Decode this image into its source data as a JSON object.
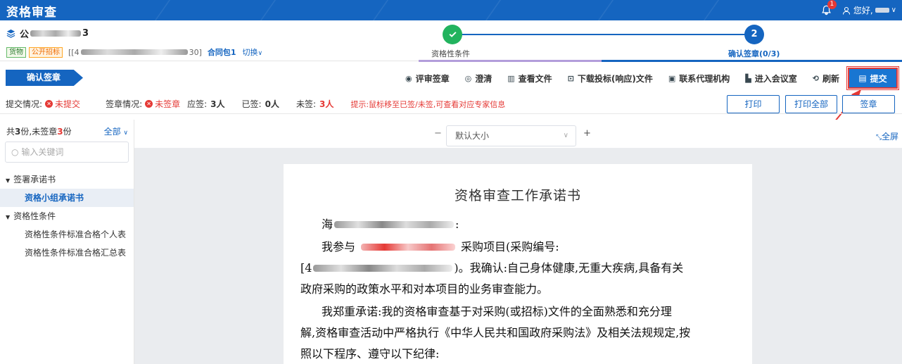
{
  "app": {
    "title": "资格审查",
    "notifications": "1",
    "greeting": "您好,"
  },
  "project": {
    "name_prefix": "公",
    "name_suffix": "3",
    "tag_goods": "货物",
    "tag_open": "公开招标",
    "code_prefix": "[[4",
    "code_suffix": "30]",
    "package": "合同包1",
    "switch": "切换"
  },
  "steps": [
    {
      "label": "资格性条件",
      "state": "done"
    },
    {
      "number": "2",
      "label": "确认签章(0/3)",
      "state": "active"
    }
  ],
  "action_bar": {
    "tab": "确认签章",
    "actions": [
      "评审签章",
      "澄清",
      "查看文件",
      "下载投标(响应)文件",
      "联系代理机构",
      "进入会议室",
      "刷新"
    ],
    "submit": "提交"
  },
  "status": {
    "submit_label": "提交情况:",
    "submit_value": "未提交",
    "sign_label": "签章情况:",
    "sign_value": "未签章",
    "should_label": "应签:",
    "should_value": "3人",
    "signed_label": "已签:",
    "signed_value": "0人",
    "unsigned_label": "未签:",
    "unsigned_value": "3人",
    "hint": "提示:鼠标移至已签/未签,可查看对应专家信息"
  },
  "buttons": {
    "print": "打印",
    "print_all": "打印全部",
    "sign": "签章"
  },
  "sidebar": {
    "summary_a": "共",
    "summary_n1": "3",
    "summary_b": "份,未签章",
    "summary_n2": "3",
    "summary_c": "份",
    "filter": "全部",
    "search_placeholder": "输入关键词",
    "tree": [
      {
        "label": "签署承诺书",
        "level": 0
      },
      {
        "label": "资格小组承诺书",
        "level": 1,
        "selected": true
      },
      {
        "label": "资格性条件",
        "level": 0
      },
      {
        "label": "资格性条件标准合格个人表",
        "level": 1
      },
      {
        "label": "资格性条件标准合格汇总表",
        "level": 1
      }
    ]
  },
  "viewer": {
    "zoom_minus": "−",
    "zoom_value": "默认大小",
    "zoom_plus": "+",
    "fullscreen": "全屏"
  },
  "document": {
    "title": "资格审查工作承诺书",
    "l1_start": "海",
    "l1_end": ":",
    "l2_start": "我参与",
    "l2_end": "采购项目(采购编号:",
    "l3_start": "[4",
    "l3_end": ")。我确认:自己身体健康,无重大疾病,具备有关",
    "l4": "政府采购的政策水平和对本项目的业务审查能力。",
    "l5": "我郑重承诺:我的资格审查基于对采购(或招标)文件的全面熟悉和充分理",
    "l6": "解,资格审查活动中严格执行《中华人民共和国政府采购法》及相关法规规定,按",
    "l7": "照以下程序、遵守以下纪律:"
  },
  "colors": {
    "primary": "#1565c0",
    "success": "#22b35e",
    "danger": "#e53935"
  }
}
